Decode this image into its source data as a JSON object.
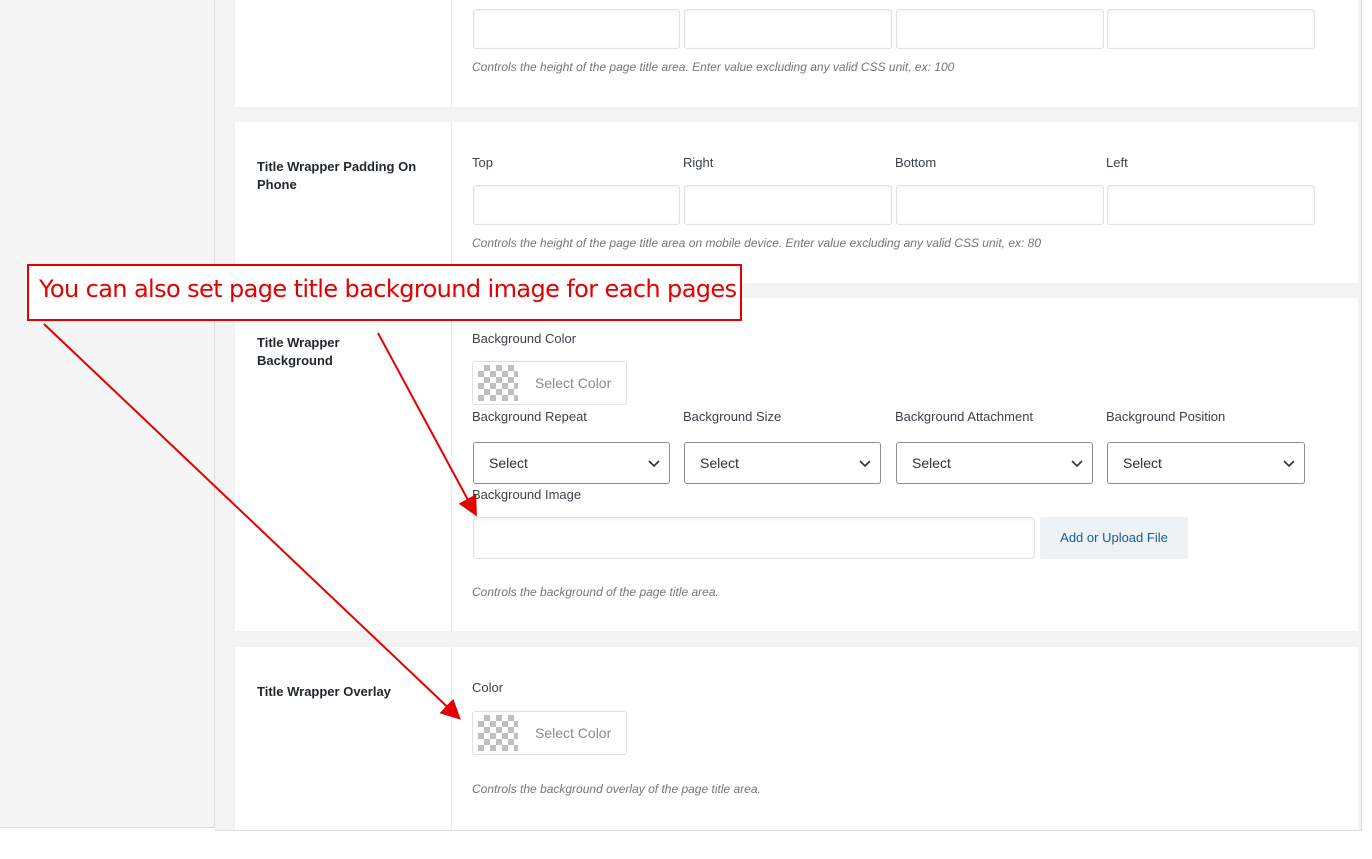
{
  "height_section": {
    "description": "Controls the height of the page title area. Enter value excluding any valid CSS unit, ex: 100"
  },
  "padding_phone_section": {
    "label": "Title Wrapper Padding On Phone",
    "fields": [
      "Top",
      "Right",
      "Bottom",
      "Left"
    ],
    "description": "Controls the height of the page title area on mobile device. Enter value excluding any valid CSS unit, ex: 80"
  },
  "annotation": {
    "text": "You can also set  page title background image for each pages",
    "color": "#e30000"
  },
  "background_section": {
    "label": "Title Wrapper Background",
    "color_label": "Background Color",
    "select_color": "Select Color",
    "selects": [
      {
        "label": "Background Repeat",
        "value": "Select"
      },
      {
        "label": "Background Size",
        "value": "Select"
      },
      {
        "label": "Background Attachment",
        "value": "Select"
      },
      {
        "label": "Background Position",
        "value": "Select"
      }
    ],
    "image_label": "Background Image",
    "upload_button": "Add or Upload File",
    "description": "Controls the background of the page title area."
  },
  "overlay_section": {
    "label": "Title Wrapper Overlay",
    "color_label": "Color",
    "select_color": "Select Color",
    "description": "Controls the background overlay of the page title area."
  }
}
